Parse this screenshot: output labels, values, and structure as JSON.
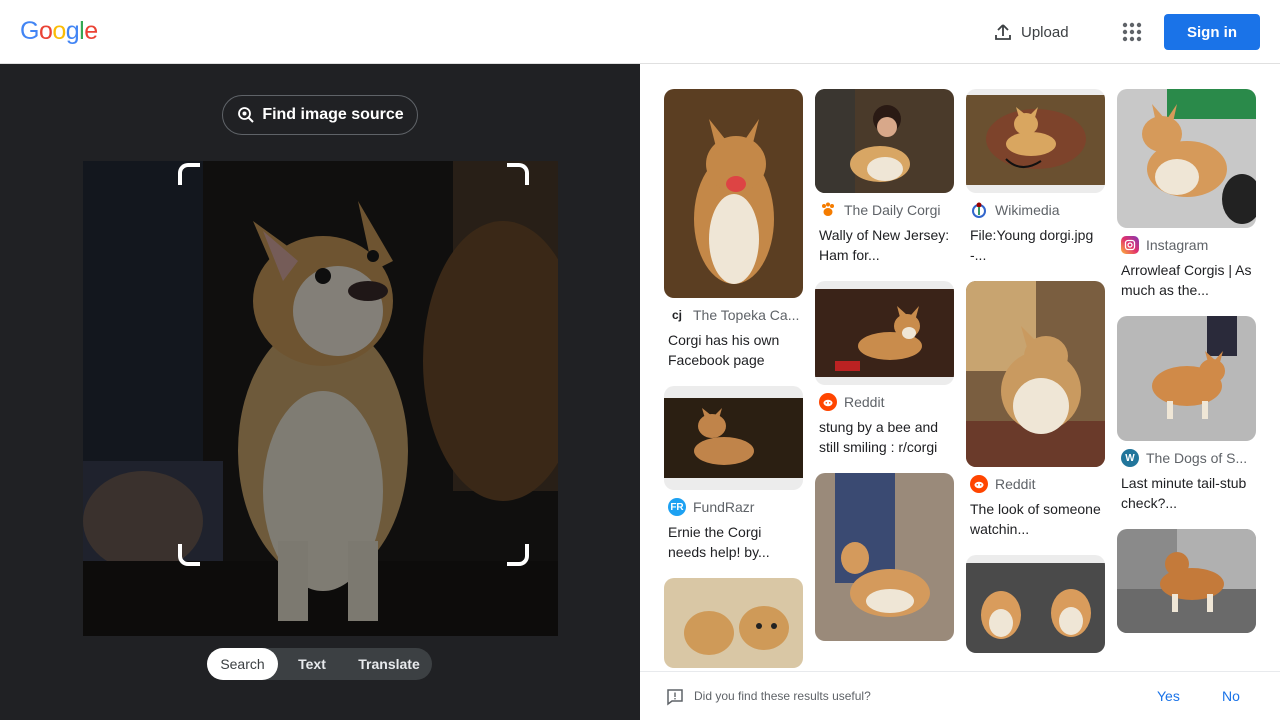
{
  "header": {
    "logo_letters": [
      "G",
      "o",
      "o",
      "g",
      "l",
      "e"
    ],
    "logo_colors": [
      "#4285F4",
      "#EA4335",
      "#FBBC05",
      "#4285F4",
      "#34A853",
      "#EA4335"
    ],
    "upload_label": "Upload",
    "upload_icon": "upload-icon",
    "apps_icon": "apps-grid-icon",
    "signin_label": "Sign in"
  },
  "lens": {
    "find_source_label": "Find image source",
    "find_source_icon": "lens-search-icon",
    "modes": [
      "Search",
      "Text",
      "Translate"
    ],
    "active_mode": "Search"
  },
  "results": {
    "columns": [
      [
        {
          "source": "The Topeka Ca...",
          "favicon": "cj",
          "favicon_color": "#202124",
          "title": "Corgi has his own Facebook page"
        },
        {
          "source": "FundRazr",
          "favicon": "FR",
          "favicon_color": "#1da1f2",
          "title": "Ernie the Corgi needs help! by..."
        },
        {
          "source": "",
          "favicon": "",
          "favicon_color": "",
          "title": ""
        }
      ],
      [
        {
          "source": "The Daily Corgi",
          "favicon": "paw",
          "favicon_color": "#f57c00",
          "title": "Wally of New Jersey: Ham for..."
        },
        {
          "source": "Reddit",
          "favicon": "reddit",
          "favicon_color": "#ff4500",
          "title": "stung by a bee and still smiling : r/corgi"
        },
        {
          "source": "",
          "favicon": "",
          "favicon_color": "",
          "title": ""
        }
      ],
      [
        {
          "source": "Wikimedia",
          "favicon": "wiki",
          "favicon_color": "#3366cc",
          "title": "File:Young dorgi.jpg -..."
        },
        {
          "source": "Reddit",
          "favicon": "reddit",
          "favicon_color": "#ff4500",
          "title": "The look of someone watchin..."
        },
        {
          "source": "",
          "favicon": "",
          "favicon_color": "",
          "title": ""
        }
      ],
      [
        {
          "source": "Instagram",
          "favicon": "ig",
          "favicon_color": "#d6249f",
          "title": "Arrowleaf Corgis | As much as the..."
        },
        {
          "source": "The Dogs of S...",
          "favicon": "W",
          "favicon_color": "#21759b",
          "title": "Last minute tail-stub check?..."
        },
        {
          "source": "",
          "favicon": "",
          "favicon_color": "",
          "title": ""
        }
      ]
    ]
  },
  "feedback": {
    "question": "Did you find these results useful?",
    "yes": "Yes",
    "no": "No"
  }
}
